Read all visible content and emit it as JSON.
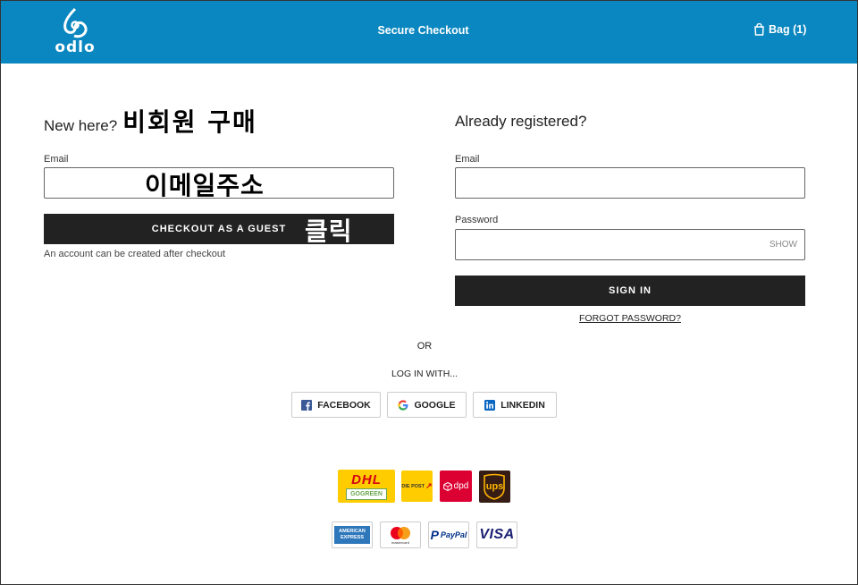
{
  "header": {
    "logo_text": "odlo",
    "title": "Secure Checkout",
    "bag_label": "Bag (1)"
  },
  "guest": {
    "heading": "New here?",
    "heading_annotation": "비회원 구매",
    "email_label": "Email",
    "email_annotation": "이메일주소",
    "button_label": "CHECKOUT AS A GUEST",
    "button_annotation": "클릭",
    "note": "An account can be created after checkout"
  },
  "login": {
    "heading": "Already registered?",
    "email_label": "Email",
    "email_value": "",
    "password_label": "Password",
    "password_value": "",
    "show_label": "SHOW",
    "signin_label": "SIGN IN",
    "forgot_label": "FORGOT PASSWORD?"
  },
  "or_label": "OR",
  "login_with_label": "LOG IN WITH...",
  "social": [
    {
      "label": "FACEBOOK",
      "icon": "facebook-icon",
      "color": "#3b5998"
    },
    {
      "label": "GOOGLE",
      "icon": "google-icon",
      "color": "#4285f4"
    },
    {
      "label": "LINKEDIN",
      "icon": "linkedin-icon",
      "color": "#0a66c2"
    }
  ],
  "shipping": {
    "dhl": "DHL",
    "gogreen": "GOGREEN",
    "diepost": "DIE POST",
    "dpd": "dpd",
    "ups": "ups"
  },
  "payment": {
    "amex_line1": "AMERICAN",
    "amex_line2": "EXPRESS",
    "mastercard_text": "mastercard",
    "paypal": "PayPal",
    "visa": "VISA"
  },
  "colors": {
    "header_bg": "#0a87c0",
    "button_bg": "#222222"
  }
}
